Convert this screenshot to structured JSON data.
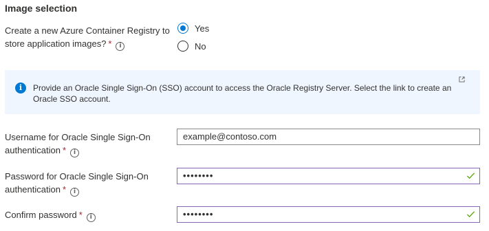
{
  "section": {
    "title": "Image selection"
  },
  "registry": {
    "label": "Create a new Azure Container Registry to store application images?",
    "required_mark": "*",
    "info_icon": "info-icon",
    "options": [
      {
        "label": "Yes",
        "selected": true
      },
      {
        "label": "No",
        "selected": false
      }
    ]
  },
  "banner": {
    "icon": "info-icon",
    "text": "Provide an Oracle Single Sign-On (SSO) account to access the Oracle Registry Server. Select the link to create an Oracle SSO account.",
    "link_icon": "external-link-icon"
  },
  "username": {
    "label": "Username for Oracle Single Sign-On authentication",
    "required_mark": "*",
    "value": "example@contoso.com"
  },
  "password": {
    "label": "Password for Oracle Single Sign-On authentication",
    "required_mark": "*",
    "value": "••••••••",
    "valid": true
  },
  "confirm": {
    "label": "Confirm password",
    "required_mark": "*",
    "value": "••••••••",
    "valid": true
  },
  "colors": {
    "accent": "#0078d4",
    "required": "#a4262c",
    "banner_bg": "#f0f6ff",
    "valid_border": "#8764b8",
    "check": "#57a300"
  }
}
